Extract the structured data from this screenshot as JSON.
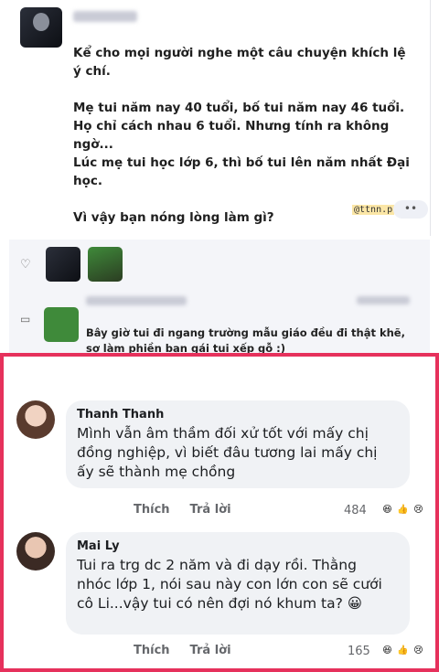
{
  "post": {
    "paragraphs": [
      "Kể cho mọi người nghe một câu chuyện khích lệ\ný chí.",
      "Mẹ tui năm nay 40 tuổi, bố tui năm nay 46 tuổi.\nHọ chỉ cách nhau 6 tuổi. Nhưng tính ra không ngờ...\nLúc mẹ tui học lớp 6, thì bố tui lên năm nhất Đại học.",
      "Vì vậy bạn nóng lòng làm gì?"
    ],
    "tag": "@ttnn.p",
    "more_icon": "••"
  },
  "reply": {
    "text": "Bây giờ tui đi ngang trường mẫu giáo đều đi thật khẽ,\nsợ làm phiền bạn gái tui xếp gỗ :)"
  },
  "comments": [
    {
      "name": "Thanh Thanh",
      "text": "Mình vẫn âm thầm đối xử tốt với mấy chị\nđồng nghiệp, vì biết đâu tương lai mấy chị\nấy sẽ thành mẹ chồng",
      "like": "Thích",
      "reply": "Trả lời",
      "count": "484"
    },
    {
      "name": "Mai Ly",
      "text": "Tui ra trg dc 2 năm và đi dạy rồi. Thằng\nnhóc lớp 1, nói sau này con lớn con sẽ cưới\ncô Li...vậy tui có nên đợi nó khum ta? 😀",
      "like": "Thích",
      "reply": "Trả lời",
      "count": "165"
    }
  ],
  "icons": {
    "heart": "♡",
    "comment": "▭",
    "haha": "😆",
    "like": "👍",
    "sad": "😢"
  },
  "colors": {
    "frame": "#e6315c",
    "bubble": "#f0f2f5",
    "muted": "#65676b"
  }
}
